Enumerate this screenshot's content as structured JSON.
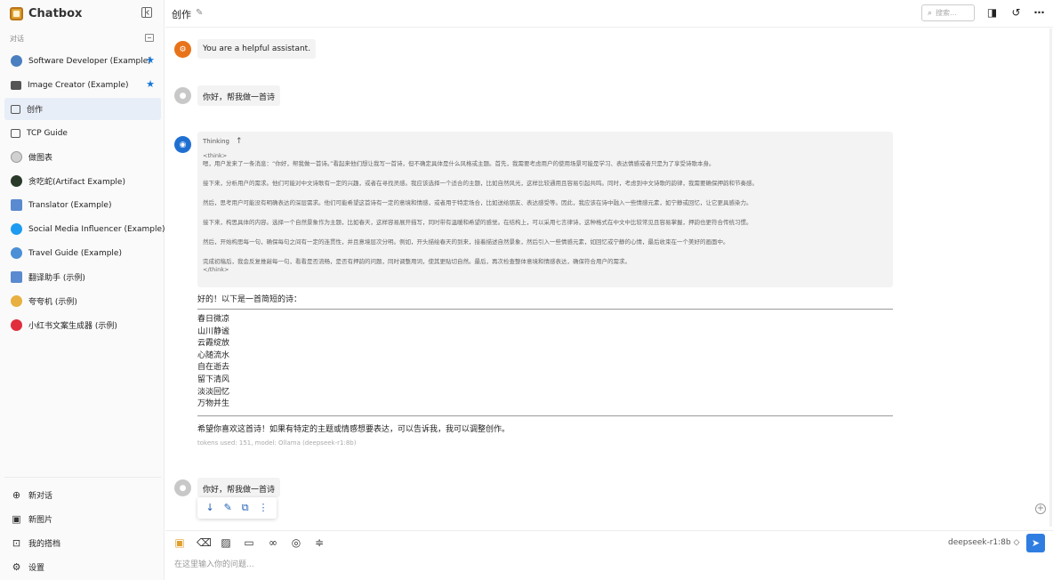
{
  "app": {
    "name": "Chatbox"
  },
  "sidebar": {
    "section_label": "对话",
    "items": [
      {
        "label": "Software Developer (Example)",
        "icon": "developer-avatar-icon",
        "starred": true,
        "color": "#4a7fc0"
      },
      {
        "label": "Image Creator (Example)",
        "icon": "image-creator-avatar-icon",
        "starred": true,
        "color": "#555555"
      },
      {
        "label": "创作",
        "icon": "chat-bubble-icon",
        "active": true
      },
      {
        "label": "TCP Guide",
        "icon": "chat-bubble-icon"
      },
      {
        "label": "做图表",
        "icon": "chart-avatar-icon",
        "color": "#c8c8c8"
      },
      {
        "label": "贪吃蛇(Artifact Example)",
        "icon": "snake-avatar-icon",
        "color": "#2a3a2a"
      },
      {
        "label": "Translator (Example)",
        "icon": "translator-avatar-icon",
        "color": "#5a8ad0"
      },
      {
        "label": "Social Media Influencer (Example)",
        "icon": "twitter-avatar-icon",
        "color": "#1d9bf0"
      },
      {
        "label": "Travel Guide (Example)",
        "icon": "travel-avatar-icon",
        "color": "#4b8fd6"
      },
      {
        "label": "翻译助手 (示例)",
        "icon": "translator-cn-avatar-icon",
        "color": "#5a8ad0"
      },
      {
        "label": "夸夸机 (示例)",
        "icon": "praise-avatar-icon",
        "color": "#e8b040"
      },
      {
        "label": "小红书文案生成器 (示例)",
        "icon": "xiaohongshu-avatar-icon",
        "color": "#e02e3c"
      }
    ],
    "actions": [
      {
        "label": "新对话",
        "icon": "plus-circle-icon"
      },
      {
        "label": "新图片",
        "icon": "image-icon"
      },
      {
        "label": "我的搭档",
        "icon": "robot-icon"
      },
      {
        "label": "设置",
        "icon": "gear-icon"
      }
    ]
  },
  "header": {
    "title": "创作",
    "search_placeholder": "搜索..."
  },
  "messages": {
    "system": "You are a helpful assistant.",
    "user1": "你好，帮我做一首诗",
    "thinking_label": "Thinking",
    "think_open": "<think>",
    "think_close": "</think>",
    "think_paras": [
      "嗯，用户发来了一条消息：“你好，帮我做一首诗。”看起来他们想让我写一首诗，但不确定具体是什么风格或主题。首先，我需要考虑用户的使用场景可能是学习、表达情感或者只是为了享受诗歌本身。",
      "接下来，分析用户的需求。他们可能对中文诗歌有一定的兴趣，或者在寻找灵感。我应该选择一个适合的主题，比如自然风光，这样比较通用且容易引起共鸣。同时，考虑到中文诗歌的韵律，我需要确保押韵和节奏感。",
      "然后，思考用户可能没有明确表达的深层需求。他们可能希望这首诗有一定的意境和情感，或者用于特定场合，比如送给朋友、表达感受等。因此，我应该在诗中融入一些情感元素，如宁静或回忆，让它更具感染力。",
      "接下来，构思具体的内容。选择一个自然景象作为主题，比如春天，这样容易展开描写，同时带有温暖和希望的感觉。在结构上，可以采用七言律诗，这种格式在中文中比较常见且容易掌握，押韵也更符合传统习惯。",
      "然后，开始构思每一句，确保每句之间有一定的连贯性，并且意境层次分明。例如，开头描绘春天的到来，接着描述自然景象，然后引入一些情感元素，如回忆或宁静的心情，最后收束在一个美好的画面中。",
      "完成初稿后，我会反复推敲每一句，看看是否流畅，是否有押韵的问题，同时调整用词，使其更贴切自然。最后，再次检查整体意境和情感表达，确保符合用户的需求。"
    ],
    "answer_intro": "好的！以下是一首简短的诗：",
    "poem_lines": [
      "春日微凉",
      "山川静谧",
      "云霞绽放",
      "心随流水",
      "自在逝去",
      "留下清风",
      "淡淡回忆",
      "万物并生"
    ],
    "answer_outro": "希望你喜欢这首诗！如果有特定的主题或情感想要表达，可以告诉我，我可以调整创作。",
    "tokens_info": "tokens used: 151, model: Ollama (deepseek-r1:8b)",
    "user2": "你好，帮我做一首诗"
  },
  "composer": {
    "placeholder": "在这里输入你的问题...",
    "model": "deepseek-r1:8b"
  },
  "colors": {
    "accent": "#2f7de1",
    "system_avatar": "#e8731a",
    "assistant_avatar": "#1f6fd1",
    "user_avatar": "#c8c8c8"
  }
}
